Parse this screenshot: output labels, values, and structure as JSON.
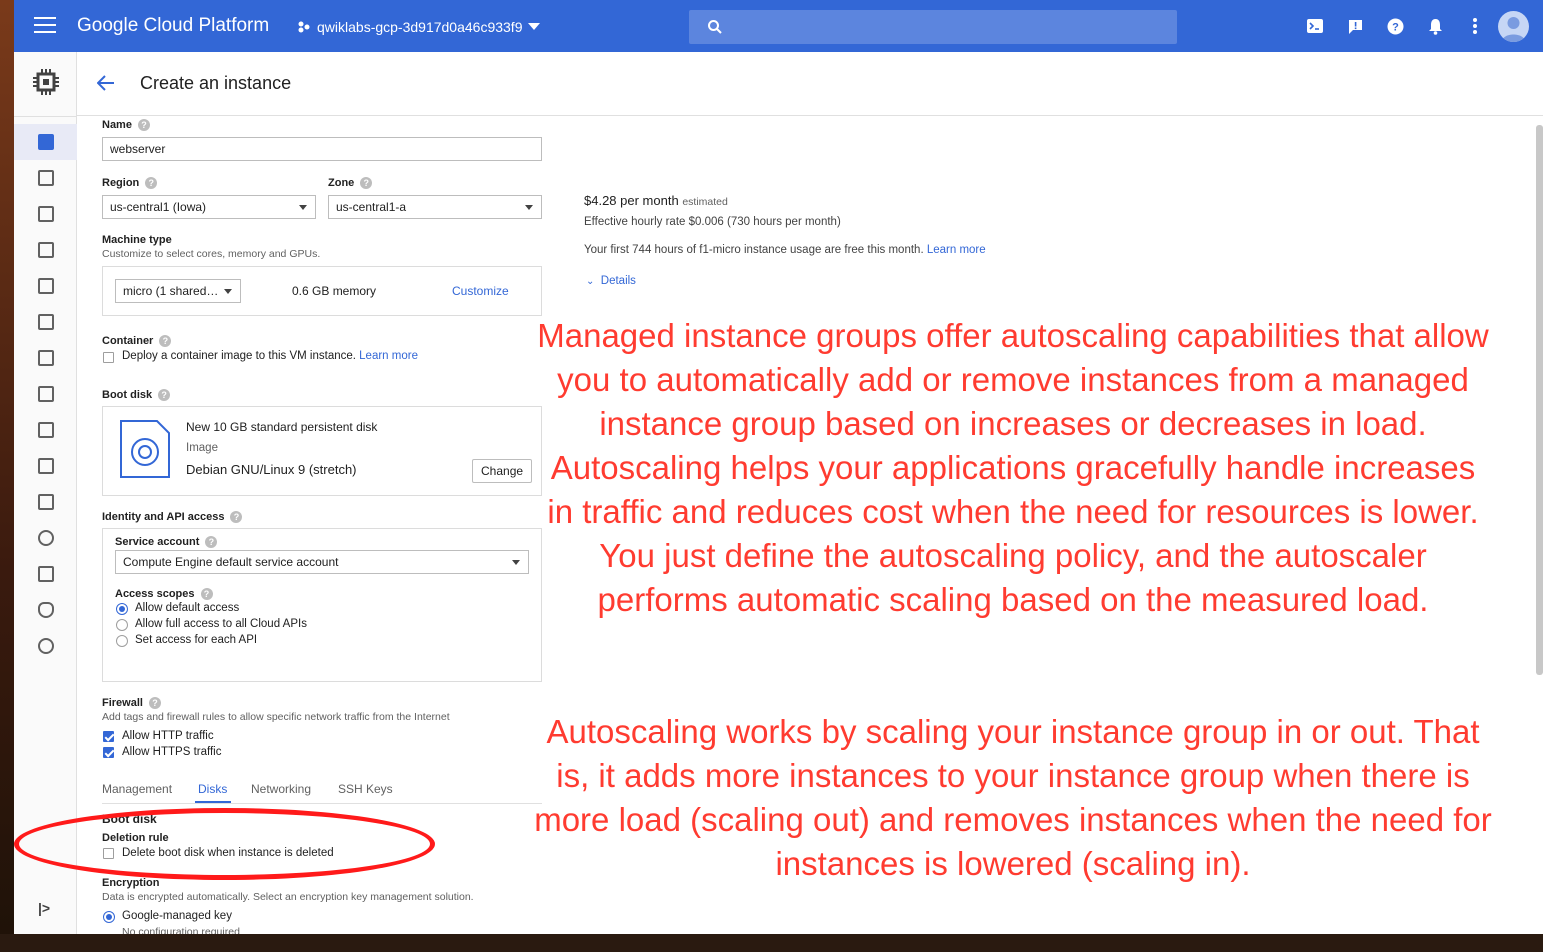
{
  "topbar": {
    "brand": "Google Cloud Platform",
    "project": "qwiklabs-gcp-3d917d0a46c933f9"
  },
  "icons": [
    "menu-icon",
    "search-icon",
    "cloud-shell-icon",
    "feedback-icon",
    "help-icon",
    "notifications-icon",
    "more-vert-icon",
    "account-icon",
    "compute-engine-icon",
    "back-arrow-icon"
  ],
  "header": {
    "title": "Create an instance"
  },
  "form": {
    "name_label": "Name",
    "name_value": "webserver",
    "region_label": "Region",
    "region_value": "us-central1 (Iowa)",
    "zone_label": "Zone",
    "zone_value": "us-central1-a",
    "machine_type_label": "Machine type",
    "machine_type_sub": "Customize to select cores, memory and GPUs.",
    "machine_value": "micro (1 shared…",
    "memory": "0.6 GB memory",
    "customize": "Customize",
    "container_label": "Container",
    "container_text": "Deploy a container image to this VM instance.",
    "learn_more": "Learn more",
    "boot_disk_label": "Boot disk",
    "boot_disk_title": "New 10 GB standard persistent disk",
    "boot_disk_image_label": "Image",
    "boot_disk_image": "Debian GNU/Linux 9 (stretch)",
    "change": "Change",
    "identity_label": "Identity and API access",
    "service_account_label": "Service account",
    "service_account_value": "Compute Engine default service account",
    "access_scopes_label": "Access scopes",
    "scope_default": "Allow default access",
    "scope_full": "Allow full access to all Cloud APIs",
    "scope_each": "Set access for each API",
    "firewall_label": "Firewall",
    "firewall_sub": "Add tags and firewall rules to allow specific network traffic from the Internet",
    "allow_http": "Allow HTTP traffic",
    "allow_https": "Allow HTTPS traffic",
    "tabs": [
      "Management",
      "Disks",
      "Networking",
      "SSH Keys"
    ],
    "disks_boot_disk": "Boot disk",
    "deletion_rule": "Deletion rule",
    "delete_boot_disk": "Delete boot disk when instance is deleted",
    "encryption_label": "Encryption",
    "encryption_sub": "Data is encrypted automatically. Select an encryption key management solution.",
    "google_managed": "Google-managed key",
    "no_config": "No configuration required"
  },
  "pricing": {
    "price": "$4.28 per month",
    "estimated": "estimated",
    "hourly": "Effective hourly rate $0.006 (730 hours per month)",
    "free_tier": "Your first 744 hours of f1-micro instance usage are free this month.",
    "learn_more": "Learn more",
    "details": "Details"
  },
  "annotation": {
    "paragraph1": "Managed instance groups offer autoscaling capabilities that allow you to automatically add or remove instances from a managed instance group based on increases or decreases in load. Autoscaling helps your applications gracefully handle increases in traffic and reduces cost when the need for resources is lower. You just define the autoscaling policy, and the autoscaler performs automatic scaling based on the measured load.",
    "paragraph2": "Autoscaling works by scaling your instance group in or out. That is, it adds more instances to your instance group when there is more load (scaling out) and removes instances when the need for instances is lowered (scaling in).",
    "color": "#ff3b30"
  },
  "colors": {
    "topbar": "#3367d6",
    "accent": "#3367d6"
  }
}
